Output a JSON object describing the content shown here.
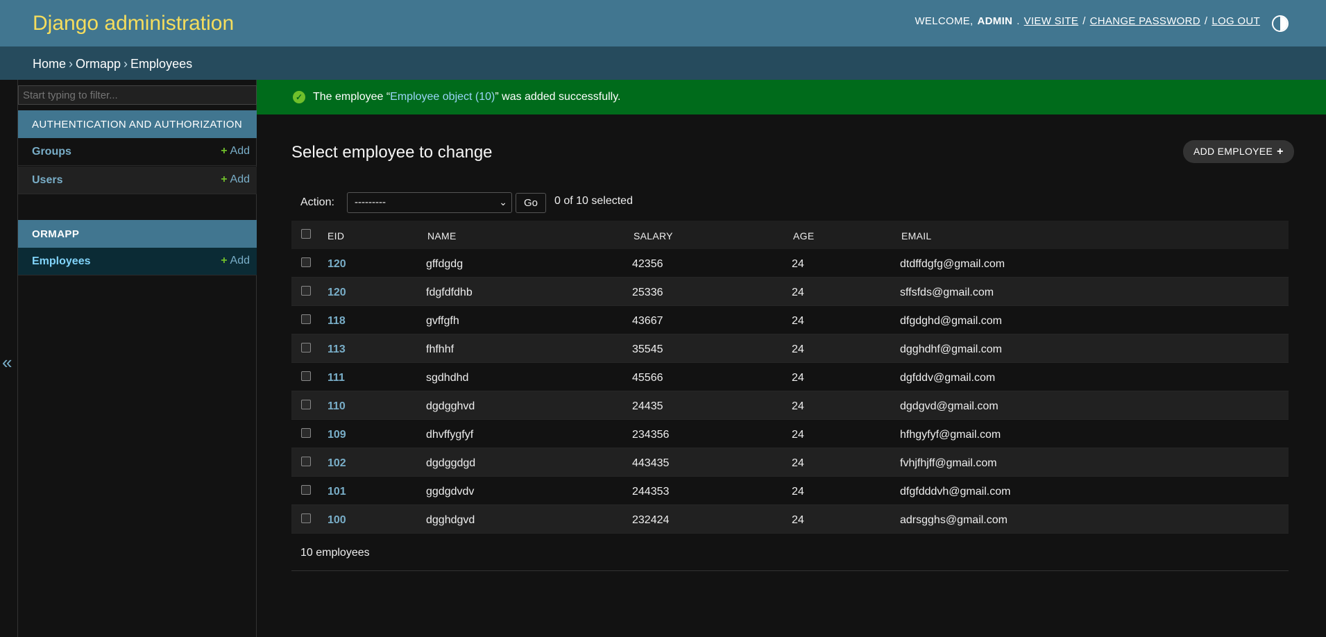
{
  "header": {
    "site_name": "Django administration",
    "welcome": "WELCOME,",
    "user": "ADMIN",
    "view_site": "VIEW SITE",
    "change_password": "CHANGE PASSWORD",
    "log_out": "LOG OUT",
    "sep": "/"
  },
  "breadcrumbs": {
    "home": "Home",
    "app": "Ormapp",
    "current": "Employees",
    "sep": "›"
  },
  "sidebar": {
    "filter_placeholder": "Start typing to filter...",
    "collapse_glyph": "«",
    "apps": [
      {
        "caption": "AUTHENTICATION AND AUTHORIZATION",
        "models": [
          {
            "name": "Groups",
            "add": "Add"
          },
          {
            "name": "Users",
            "add": "Add"
          }
        ]
      },
      {
        "caption": "ORMAPP",
        "models": [
          {
            "name": "Employees",
            "add": "Add"
          }
        ]
      }
    ]
  },
  "message": {
    "prefix": "The employee “",
    "object": "Employee object (10)",
    "suffix": "” was added successfully."
  },
  "content": {
    "title": "Select employee to change",
    "add_button": "ADD EMPLOYEE"
  },
  "actions": {
    "label": "Action:",
    "selected_option": "---------",
    "go": "Go",
    "counter": "0 of 10 selected"
  },
  "table": {
    "headers": [
      "EID",
      "NAME",
      "SALARY",
      "AGE",
      "EMAIL"
    ],
    "rows": [
      {
        "eid": "120",
        "name": "gffdgdg",
        "salary": "42356",
        "age": "24",
        "email": "dtdffdgfg@gmail.com"
      },
      {
        "eid": "120",
        "name": "fdgfdfdhb",
        "salary": "25336",
        "age": "24",
        "email": "sffsfds@gmail.com"
      },
      {
        "eid": "118",
        "name": "gvffgfh",
        "salary": "43667",
        "age": "24",
        "email": "dfgdghd@gmail.com"
      },
      {
        "eid": "113",
        "name": "fhfhhf",
        "salary": "35545",
        "age": "24",
        "email": "dgghdhf@gmail.com"
      },
      {
        "eid": "111",
        "name": "sgdhdhd",
        "salary": "45566",
        "age": "24",
        "email": "dgfddv@gmail.com"
      },
      {
        "eid": "110",
        "name": "dgdgghvd",
        "salary": "24435",
        "age": "24",
        "email": "dgdgvd@gmail.com"
      },
      {
        "eid": "109",
        "name": "dhvffygfyf",
        "salary": "234356",
        "age": "24",
        "email": "hfhgyfyf@gmail.com"
      },
      {
        "eid": "102",
        "name": "dgdggdgd",
        "salary": "443435",
        "age": "24",
        "email": "fvhjfhjff@gmail.com"
      },
      {
        "eid": "101",
        "name": "ggdgdvdv",
        "salary": "244353",
        "age": "24",
        "email": "dfgfdddvh@gmail.com"
      },
      {
        "eid": "100",
        "name": "dgghdgvd",
        "salary": "232424",
        "age": "24",
        "email": "adrsgghs@gmail.com"
      }
    ]
  },
  "paginator": {
    "count": "10 employees"
  }
}
